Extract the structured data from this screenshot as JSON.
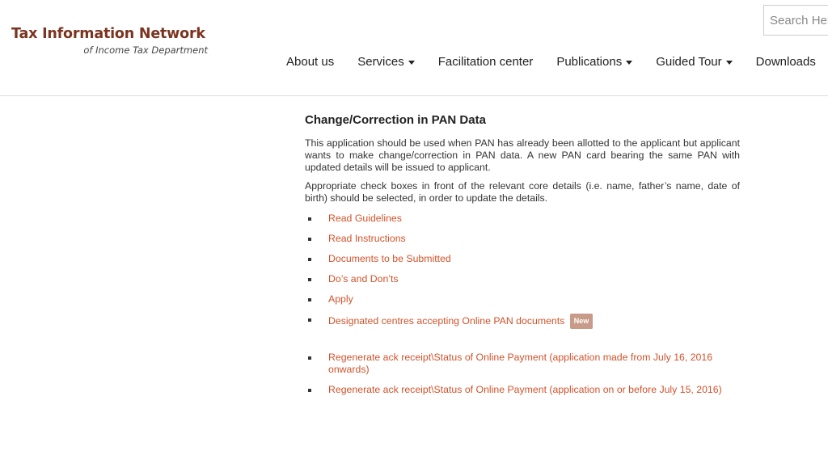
{
  "header": {
    "brand_title": "Tax Information Network",
    "brand_subtitle": "of Income Tax Department",
    "search_placeholder": "Search Here",
    "nav": [
      {
        "label": "About us",
        "has_dropdown": false
      },
      {
        "label": "Services",
        "has_dropdown": true
      },
      {
        "label": "Facilitation center",
        "has_dropdown": false
      },
      {
        "label": "Publications",
        "has_dropdown": true
      },
      {
        "label": "Guided Tour",
        "has_dropdown": true
      },
      {
        "label": "Downloads",
        "has_dropdown": false
      }
    ]
  },
  "main": {
    "title": "Change/Correction in PAN Data",
    "paragraphs": [
      "This application should be used when PAN has already been allotted to the applicant but applicant wants to make change/correction in PAN data. A new PAN card bearing the same PAN with updated details will be issued to applicant.",
      "Appropriate check boxes in front of the relevant core details (i.e. name, father’s name, date of birth) should be selected, in order to update the details."
    ],
    "links": [
      {
        "label": "Read Guidelines"
      },
      {
        "label": "Read Instructions"
      },
      {
        "label": "Documents to be Submitted"
      },
      {
        "label": "Do’s and Don’ts"
      },
      {
        "label": "Apply"
      },
      {
        "label": "Designated centres accepting Online PAN documents",
        "badge": "New"
      }
    ],
    "payment_links": [
      {
        "label": "Regenerate ack receipt\\Status of Online Payment (application made from July 16, 2016 onwards)"
      },
      {
        "label": "Regenerate ack receipt\\Status of Online Payment (application on or before July 15, 2016)"
      }
    ]
  },
  "colors": {
    "brand": "#7b3420",
    "link": "#d2522a",
    "badge_bg": "#c79a89"
  }
}
